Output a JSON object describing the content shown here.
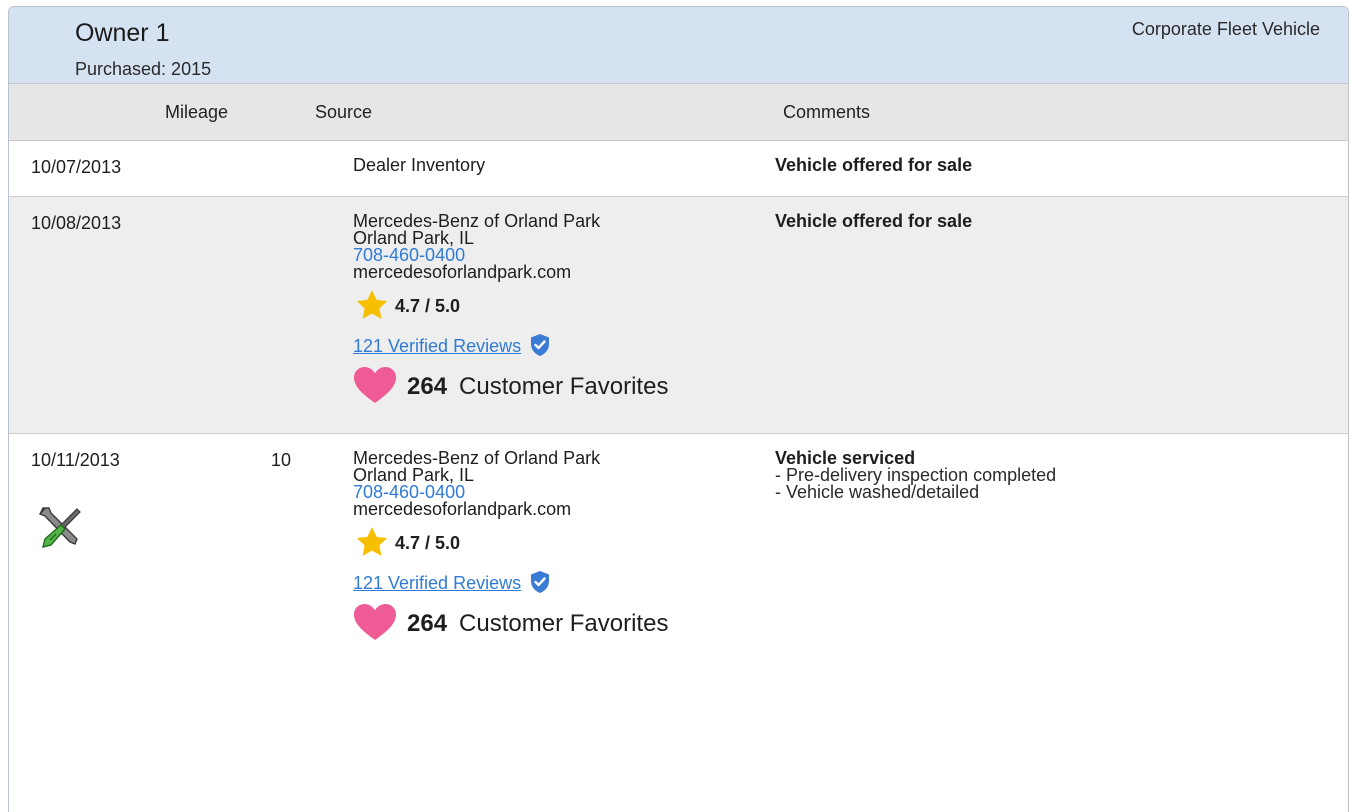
{
  "owner": {
    "title": "Owner 1",
    "purchased": "Purchased: 2015",
    "type": "Corporate Fleet Vehicle"
  },
  "columns": {
    "mileage": "Mileage",
    "source": "Source",
    "comments": "Comments"
  },
  "records": [
    {
      "date": "10/07/2013",
      "mileage": "",
      "source_name": "Dealer Inventory",
      "comment_title": "Vehicle offered for sale"
    },
    {
      "date": "10/08/2013",
      "mileage": "",
      "source_name": "Mercedes-Benz of Orland Park",
      "source_location": "Orland Park, IL",
      "source_phone": "708-460-0400",
      "source_website": "mercedesoforlandpark.com",
      "rating": "4.7 / 5.0",
      "reviews_link": "121 Verified Reviews",
      "favorites_count": "264",
      "favorites_label": "Customer Favorites",
      "comment_title": "Vehicle offered for sale"
    },
    {
      "date": "10/11/2013",
      "mileage": "10",
      "source_name": "Mercedes-Benz of Orland Park",
      "source_location": "Orland Park, IL",
      "source_phone": "708-460-0400",
      "source_website": "mercedesoforlandpark.com",
      "rating": "4.7 / 5.0",
      "reviews_link": "121 Verified Reviews",
      "favorites_count": "264",
      "favorites_label": "Customer Favorites",
      "comment_title": "Vehicle serviced",
      "comment_lines": [
        "- Pre-delivery inspection completed",
        "- Vehicle washed/detailed"
      ],
      "icon": "service-tools-icon"
    }
  ],
  "colors": {
    "header_bg": "#d4e2f2",
    "link": "#2f7bd6",
    "star": "#f6c000",
    "heart": "#ef5b95",
    "verified_badge": "#3a7bd5"
  }
}
